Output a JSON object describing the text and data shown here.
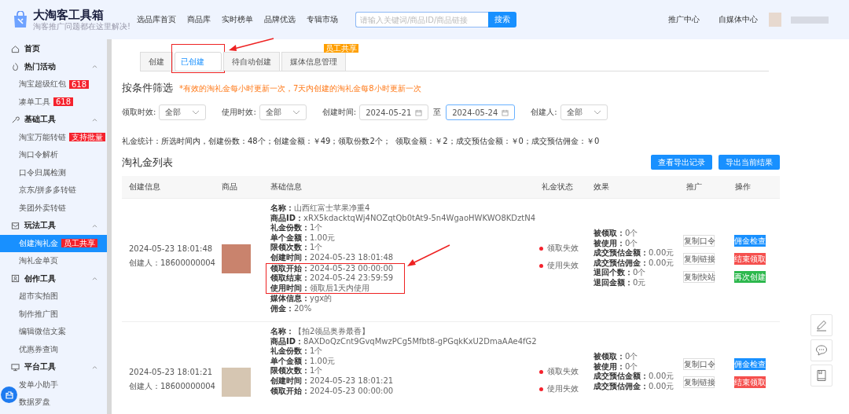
{
  "brand": {
    "title": "大淘客工具箱",
    "subtitle": "淘客推广问题都在这里解决!"
  },
  "nav": [
    "选品库首页",
    "商品库",
    "实时榜单",
    "品牌优选",
    "专辑市场"
  ],
  "search": {
    "placeholder": "请输入关键词/商品ID/商品链接",
    "button": "搜索"
  },
  "header_links": [
    "推广中心",
    "自媒体中心"
  ],
  "sidebar": [
    {
      "label": "首页"
    },
    {
      "label": "热门活动",
      "expanded": true,
      "children": [
        {
          "label": "淘宝超级红包",
          "badge": "618",
          "selected": false
        },
        {
          "label": "凑单工具",
          "badge": "618",
          "selected": false
        }
      ]
    },
    {
      "label": "基础工具",
      "expanded": true,
      "children": [
        {
          "label": "淘宝万能转链",
          "badge": "支持批量",
          "selected": false
        },
        {
          "label": "淘口令解析",
          "selected": false
        },
        {
          "label": "口令归属检测",
          "selected": false
        },
        {
          "label": "京东/拼多多转链",
          "selected": false
        },
        {
          "label": "美团外卖转链",
          "selected": false
        }
      ]
    },
    {
      "label": "玩法工具",
      "expanded": true,
      "children": [
        {
          "label": "创建淘礼金",
          "badge": "员工共享",
          "selected": true
        },
        {
          "label": "淘礼金单页",
          "selected": false
        }
      ]
    },
    {
      "label": "创作工具",
      "expanded": true,
      "children": [
        {
          "label": "超市实拍图",
          "selected": false
        },
        {
          "label": "制作推广图",
          "selected": false
        },
        {
          "label": "编辑微信文案",
          "selected": false
        },
        {
          "label": "优惠券查询",
          "selected": false
        }
      ]
    },
    {
      "label": "平台工具",
      "expanded": true,
      "children": [
        {
          "label": "发单小助手",
          "selected": false
        },
        {
          "label": "数据罗盘",
          "selected": false
        }
      ]
    }
  ],
  "tabs": [
    {
      "label": "创建",
      "selected": false,
      "highlighted": false
    },
    {
      "label": "已创建",
      "selected": true,
      "highlighted": true
    },
    {
      "label": "待自动创建",
      "selected": false,
      "highlighted": false
    },
    {
      "label": "媒体信息管理",
      "selected": false,
      "highlighted": false,
      "badge": "员工共享"
    }
  ],
  "filter": {
    "title": "按条件筛选",
    "note": "*有效的淘礼金每小时更新一次，7天内创建的淘礼金每8小时更新一次",
    "fields": [
      {
        "kind": "select",
        "label": "领取时效:",
        "value": "全部"
      },
      {
        "kind": "select",
        "label": "使用时效:",
        "value": "全部"
      },
      {
        "kind": "daterange",
        "label": "创建时间:",
        "from": "2024-05-21",
        "separator": "至",
        "to": "2024-05-24"
      },
      {
        "kind": "select",
        "label": "创建人:",
        "value": "全部"
      }
    ]
  },
  "stats": "礼金统计：所选时间内，创建份数：48个；创建金额：￥49；领取份数2个；  领取金额：￥2；成交预估金额：￥0；成交预估佣金：￥0",
  "list": {
    "title": "淘礼金列表",
    "buttons": [
      "查看导出记录",
      "导出当前结果"
    ],
    "columns": [
      "创建信息",
      "商品",
      "基础信息",
      "礼金状态",
      "效果",
      "推广",
      "操作"
    ],
    "rows": [
      {
        "created": "2024-05-23 18:01:48",
        "creator": "创建人：18600000004",
        "details": [
          {
            "label": "名称：",
            "value": "山西红富士苹果净重4",
            "highlighted": false
          },
          {
            "label": "商品ID：",
            "value": "xRX5kdacktqWj4NOZqtQb0tAt9-5n4WgaoHWKWO8KDztN4",
            "highlighted": false
          },
          {
            "label": "礼金份数：",
            "value": "1个",
            "highlighted": false
          },
          {
            "label": "单个金额：",
            "value": "1.00元",
            "highlighted": false
          },
          {
            "label": "限领次数：",
            "value": "1个",
            "highlighted": false
          },
          {
            "label": "创建时间：",
            "value": "2024-05-23 18:01:48",
            "highlighted": false
          },
          {
            "label": "领取开始：",
            "value": "2024-05-23 00:00:00",
            "highlighted": true
          },
          {
            "label": "领取结束：",
            "value": "2024-05-24 23:59:59",
            "highlighted": true
          },
          {
            "label": "使用时间：",
            "value": "领取后1天内使用",
            "highlighted": true
          },
          {
            "label": "媒体信息：",
            "value": "ygx的",
            "highlighted": false
          },
          {
            "label": "佣金：",
            "value": "20%",
            "highlighted": false
          }
        ],
        "status": [
          {
            "label": "领取失效",
            "color": "#f5222d"
          },
          {
            "label": "使用失效",
            "color": "#f5222d"
          }
        ],
        "effects": [
          {
            "label": "被领取：",
            "value": "0个"
          },
          {
            "label": "被使用：",
            "value": "0个"
          },
          {
            "label": "成交预估金额：",
            "value": "0.00元"
          },
          {
            "label": "成交预估佣金：",
            "value": "0.00元"
          },
          {
            "label": "退回个数：",
            "value": "0个"
          },
          {
            "label": "退回金额：",
            "value": "0元"
          }
        ],
        "promo": [
          "复制口令",
          "复制链接",
          "复制快站"
        ],
        "actions": [
          {
            "label": "佣金检查",
            "kind": "primary"
          },
          {
            "label": "结束领取",
            "kind": "danger"
          },
          {
            "label": "再次创建",
            "kind": "success"
          }
        ]
      },
      {
        "created": "2024-05-23 18:01:21",
        "creator": "创建人：18600000004",
        "details": [
          {
            "label": "名称：",
            "value": "【拍2领品奥券最香】",
            "highlighted": false
          },
          {
            "label": "商品ID：",
            "value": "8AXDoQzCnt9GvqMwzPCg5Mfbt8-gPGqkKxU2DmaAAe4fG2",
            "highlighted": false
          },
          {
            "label": "礼金份数：",
            "value": "1个",
            "highlighted": false
          },
          {
            "label": "单个金额：",
            "value": "1.00元",
            "highlighted": false
          },
          {
            "label": "限领次数：",
            "value": "1个",
            "highlighted": false
          },
          {
            "label": "创建时间：",
            "value": "2024-05-23 18:01:21",
            "highlighted": false
          },
          {
            "label": "领取开始：",
            "value": "2024-05-23 00:00:00",
            "highlighted": false
          }
        ],
        "status": [
          {
            "label": "领取失效",
            "color": "#f5222d"
          },
          {
            "label": "使用失效",
            "color": "#f5222d"
          }
        ],
        "effects": [
          {
            "label": "被领取：",
            "value": "0个"
          },
          {
            "label": "被使用：",
            "value": "0个"
          },
          {
            "label": "成交预估金额：",
            "value": "0.00元"
          },
          {
            "label": "成交预估佣金：",
            "value": "0.00元"
          }
        ],
        "promo": [
          "复制口令",
          "复制链接"
        ],
        "actions": [
          {
            "label": "佣金检查",
            "kind": "primary"
          },
          {
            "label": "结束领取",
            "kind": "danger"
          }
        ]
      }
    ]
  }
}
